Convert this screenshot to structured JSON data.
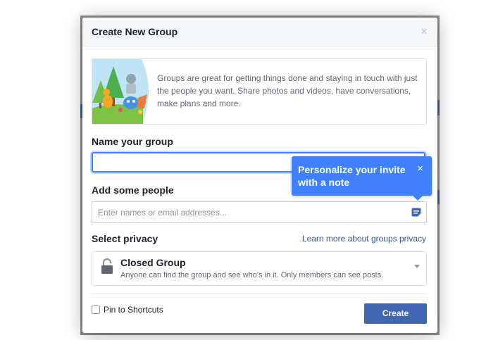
{
  "dialog": {
    "title": "Create New Group",
    "close_glyph": "×"
  },
  "intro": {
    "text": "Groups are great for getting things done and staying in touch with just the people you want. Share photos and videos, have conversations, make plans and more."
  },
  "name_group": {
    "label": "Name your group",
    "value": ""
  },
  "add_people": {
    "label": "Add some people",
    "placeholder": "Enter names or email addresses..."
  },
  "tooltip": {
    "text": "Personalize your invite with a note",
    "close_glyph": "×"
  },
  "privacy": {
    "label": "Select privacy",
    "link": "Learn more about groups privacy",
    "selected": "Closed Group",
    "description": "Anyone can find the group and see who's in it. Only members can see posts."
  },
  "footer": {
    "pin_label": "Pin to Shortcuts",
    "pin_checked": false,
    "create_label": "Create"
  },
  "colors": {
    "primary": "#4267b2",
    "tooltip": "#4080ff",
    "link": "#365899"
  },
  "icons": [
    "close-icon",
    "group-illustration",
    "note-icon",
    "lock-icon",
    "chevron-down-icon"
  ]
}
